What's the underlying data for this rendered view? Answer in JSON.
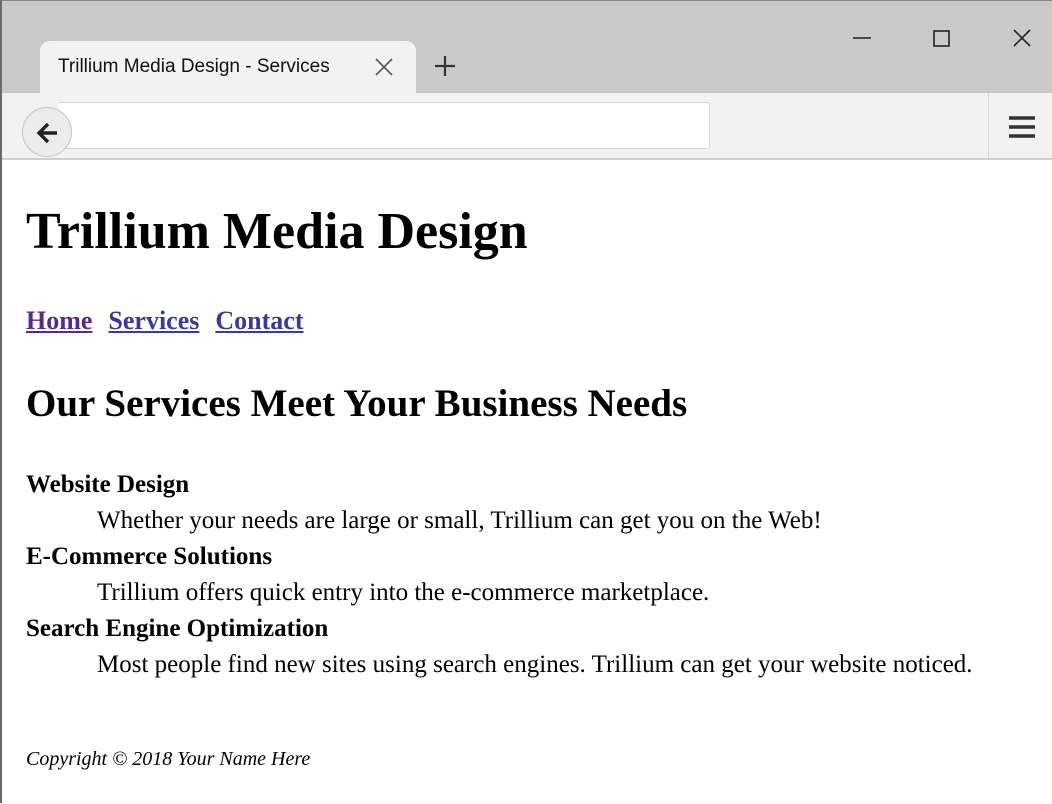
{
  "browser": {
    "tab_title": "Trillium Media Design - Services",
    "url": ""
  },
  "site": {
    "title": "Trillium Media Design",
    "nav": [
      {
        "label": "Home"
      },
      {
        "label": "Services"
      },
      {
        "label": "Contact"
      }
    ]
  },
  "main": {
    "heading": "Our Services Meet Your Business Needs",
    "services": [
      {
        "term": "Website Design",
        "description": "Whether your needs are large or small, Trillium can get you on the Web!"
      },
      {
        "term": "E-Commerce Solutions",
        "description": "Trillium offers quick entry into the e-commerce marketplace."
      },
      {
        "term": "Search Engine Optimization",
        "description": "Most people find new sites using search engines. Trillium can get your website noticed."
      }
    ]
  },
  "footer": {
    "copyright": "Copyright © 2018 Your Name Here"
  },
  "icons": {
    "tab_close": "close-icon",
    "new_tab": "plus-icon",
    "minimize": "minimize-icon",
    "maximize": "maximize-icon",
    "window_close": "close-icon",
    "back": "arrow-left-icon",
    "menu": "hamburger-menu-icon"
  },
  "colors": {
    "tab_strip": "#c9c9c9",
    "toolbar": "#f2f2f2",
    "link": "#3a3a9c",
    "visited_link": "#5c2a86"
  }
}
